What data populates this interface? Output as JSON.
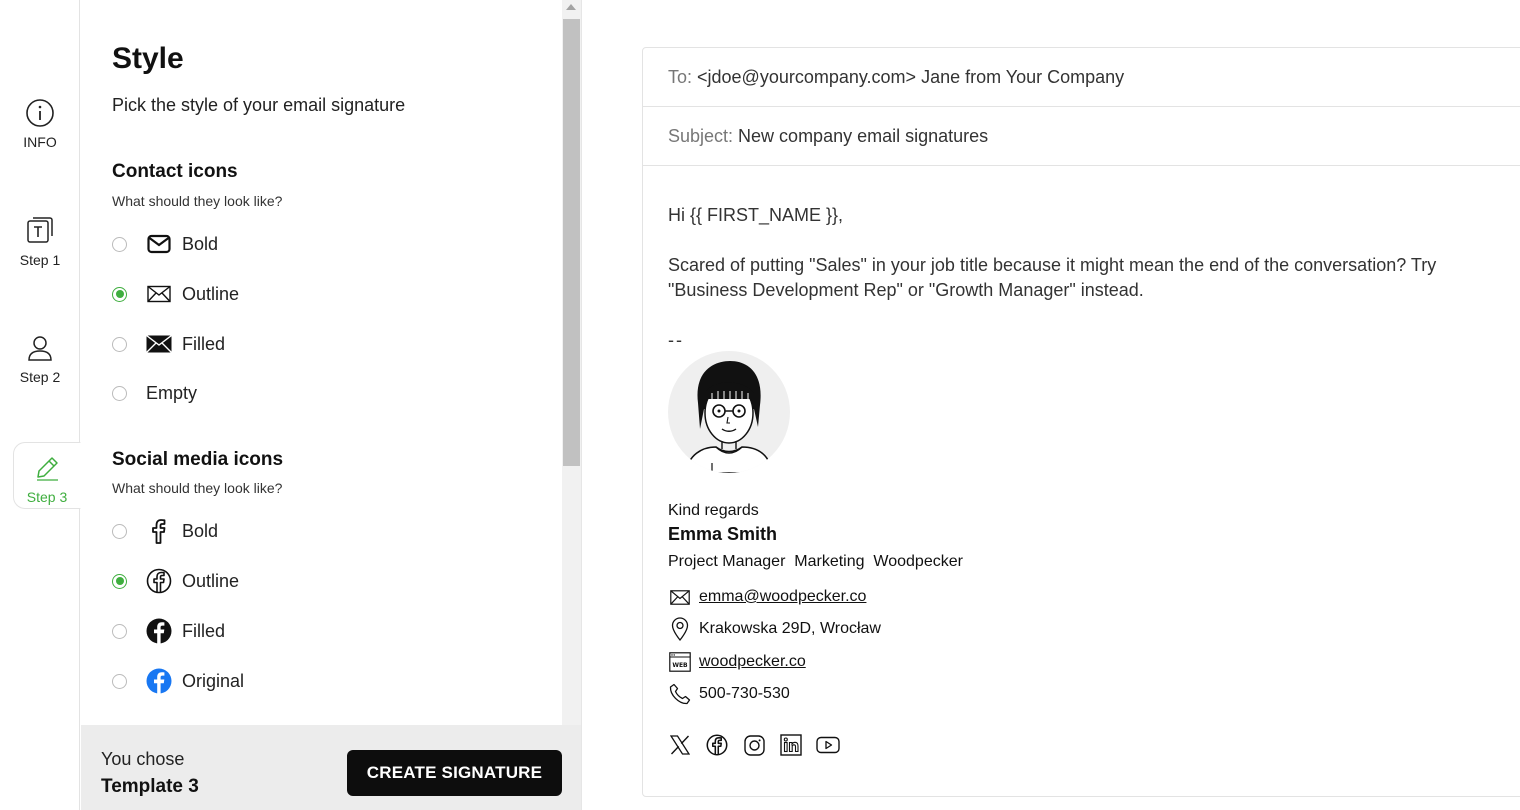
{
  "rail": {
    "items": [
      {
        "label": "INFO",
        "icon": "info-icon"
      },
      {
        "label": "Step 1",
        "icon": "text-template-icon"
      },
      {
        "label": "Step 2",
        "icon": "user-icon"
      },
      {
        "label": "Step 3",
        "icon": "pencil-icon",
        "active": true
      }
    ]
  },
  "panel": {
    "title": "Style",
    "subtitle": "Pick the style of your email signature",
    "contact_icons": {
      "title": "Contact icons",
      "hint": "What should they look like?",
      "options": [
        "Bold",
        "Outline",
        "Filled",
        "Empty"
      ],
      "selected": "Outline"
    },
    "social_icons": {
      "title": "Social media icons",
      "hint": "What should they look like?",
      "options": [
        "Bold",
        "Outline",
        "Filled",
        "Original"
      ],
      "selected": "Outline"
    }
  },
  "footer": {
    "chose_label": "You chose",
    "chose_value": "Template 3",
    "create_label": "CREATE SIGNATURE"
  },
  "email": {
    "to_label": "To:",
    "to_value": "<jdoe@yourcompany.com> Jane from Your Company",
    "subject_label": "Subject:",
    "subject_value": "New company email signatures",
    "greeting": "Hi {{ FIRST_NAME }},",
    "body": "Scared of putting \"Sales\" in your job title because it might mean the end of the conversation? Try \"Business Development Rep\" or \"Growth Manager\" instead.",
    "separator": "--"
  },
  "signature": {
    "regards": "Kind regards",
    "name": "Emma Smith",
    "role": "Project Manager  Marketing  Woodpecker",
    "email": "emma@woodpecker.co",
    "address": "Krakowska 29D, Wrocław",
    "website": "woodpecker.co",
    "phone": "500-730-530",
    "socials": [
      "x-icon",
      "facebook-icon",
      "instagram-icon",
      "linkedin-icon",
      "youtube-icon"
    ]
  },
  "colors": {
    "accent": "#3fae3f",
    "button": "#0d0d0d",
    "facebook_blue": "#1877f2"
  }
}
